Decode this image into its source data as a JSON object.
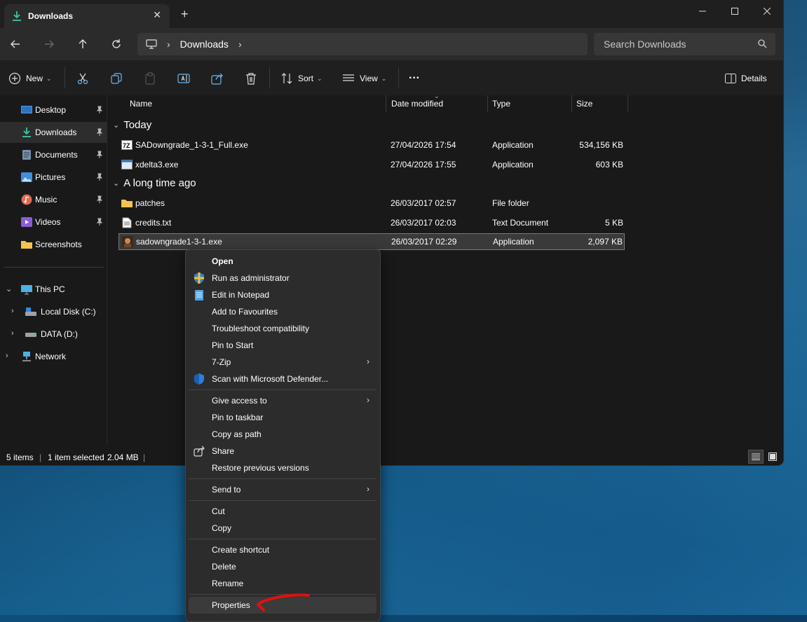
{
  "window": {
    "tab_title": "Downloads",
    "new_tab": "+",
    "close_tab": "✕"
  },
  "nav": {
    "breadcrumb": "Downloads",
    "search_placeholder": "Search Downloads"
  },
  "toolbar": {
    "new_label": "New",
    "sort_label": "Sort",
    "view_label": "View",
    "more_label": "···",
    "details_label": "Details"
  },
  "sidebar": {
    "quick": [
      {
        "label": "Desktop",
        "icon": "desktop-icon"
      },
      {
        "label": "Downloads",
        "icon": "downloads-icon"
      },
      {
        "label": "Documents",
        "icon": "documents-icon"
      },
      {
        "label": "Pictures",
        "icon": "pictures-icon"
      },
      {
        "label": "Music",
        "icon": "music-icon"
      },
      {
        "label": "Videos",
        "icon": "videos-icon"
      },
      {
        "label": "Screenshots",
        "icon": "folder-icon"
      }
    ],
    "tree": [
      {
        "label": "This PC"
      },
      {
        "label": "Local Disk (C:)"
      },
      {
        "label": "DATA (D:)"
      },
      {
        "label": "Network"
      }
    ]
  },
  "columns": {
    "name": "Name",
    "date": "Date modified",
    "type": "Type",
    "size": "Size"
  },
  "groups": {
    "today": "Today",
    "long_ago": "A long time ago"
  },
  "files": [
    {
      "name": "SADowngrade_1-3-1_Full.exe",
      "date": "27/04/2026 17:54",
      "type": "Application",
      "size": "534,156 KB",
      "icon": "7zip-exe-icon"
    },
    {
      "name": "xdelta3.exe",
      "date": "27/04/2026 17:55",
      "type": "Application",
      "size": "603 KB",
      "icon": "exe-icon"
    },
    {
      "name": "patches",
      "date": "26/03/2017 02:57",
      "type": "File folder",
      "size": "",
      "icon": "folder-icon"
    },
    {
      "name": "credits.txt",
      "date": "26/03/2017 02:03",
      "type": "Text Document",
      "size": "5 KB",
      "icon": "text-file-icon"
    },
    {
      "name": "sadowngrade1-3-1.exe",
      "date": "26/03/2017 02:29",
      "type": "Application",
      "size": "2,097 KB",
      "icon": "app-exe-icon"
    }
  ],
  "status": {
    "items": "5 items",
    "selected": "1 item selected",
    "size": "2.04 MB"
  },
  "context_menu": {
    "open": "Open",
    "run_admin": "Run as administrator",
    "edit_notepad": "Edit in Notepad",
    "add_fav": "Add to Favourites",
    "troubleshoot": "Troubleshoot compatibility",
    "pin_start": "Pin to Start",
    "zip": "7-Zip",
    "scan": "Scan with Microsoft Defender...",
    "give_access": "Give access to",
    "pin_taskbar": "Pin to taskbar",
    "copy_path": "Copy as path",
    "share": "Share",
    "restore": "Restore previous versions",
    "send_to": "Send to",
    "cut": "Cut",
    "copy": "Copy",
    "create_shortcut": "Create shortcut",
    "delete": "Delete",
    "rename": "Rename",
    "properties": "Properties"
  },
  "colors": {
    "accent": "#4cc2ff",
    "annotation": "#e01010"
  }
}
